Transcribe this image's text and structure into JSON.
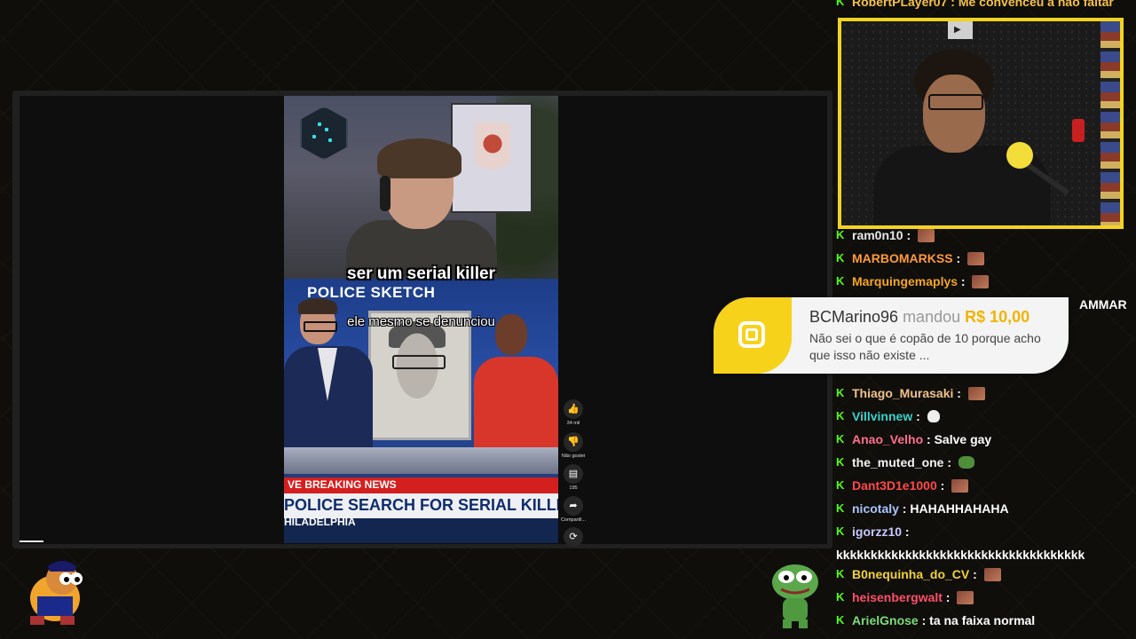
{
  "short": {
    "caption_top": "ser um serial killer",
    "sketch_title": "POLICE SKETCH",
    "caption_bottom": "ele mesmo se denunciou",
    "breaking": "VE  BREAKING NEWS",
    "ticker": "POLICE SEARCH FOR SERIAL KILLER",
    "city": "HILADELPHIA",
    "actions": {
      "like_count": "34 mil",
      "dislike_label": "Não gostei",
      "comments_count": "195",
      "share_label": "Compartil..."
    }
  },
  "donation": {
    "name": "BCMarino96",
    "verb": "mandou",
    "amount": "R$ 10,00",
    "message": "Não sei o que é copão de 10 porque acho que isso não existe ..."
  },
  "chat": {
    "partial_top": "RobertPLayer07 : Me convenceu a não faltar",
    "overflow_text": "AMMAR",
    "messages": [
      {
        "user": "ram0n10",
        "color": "#e8e8e8",
        "text": "",
        "emote": "face"
      },
      {
        "user": "MARBOMARKSS",
        "color": "#ff9a3c",
        "text": "",
        "emote": "face"
      },
      {
        "user": "Marquingemaplys",
        "color": "#f5a623",
        "text": "",
        "emote": "face"
      },
      {
        "user": "Thiago_Murasaki",
        "color": "#f0c28a",
        "text": "",
        "emote": "face"
      },
      {
        "user": "Villvinnew",
        "color": "#3ad1c9",
        "text": "",
        "emote": "skull"
      },
      {
        "user": "Anao_Velho",
        "color": "#ff6f8c",
        "text": "Salve gay",
        "emote": ""
      },
      {
        "user": "the_muted_one",
        "color": "#f2f2f2",
        "text": "",
        "emote": "frog"
      },
      {
        "user": "Dant3D1e1000",
        "color": "#ff4a4a",
        "text": "",
        "emote": "face"
      },
      {
        "user": "nicotaly",
        "color": "#a9c6ff",
        "text": "HAHAHHAHAHA",
        "emote": ""
      },
      {
        "user": "igorzz10",
        "color": "#c8c8ff",
        "text": "",
        "emote": ""
      },
      {
        "user": "B0nequinha_do_CV",
        "color": "#f2d13a",
        "text": "",
        "emote": "face"
      },
      {
        "user": "heisenbergwalt",
        "color": "#ff4f6a",
        "text": "",
        "emote": "face"
      },
      {
        "user": "ArielGnose",
        "color": "#7ddc7a",
        "text": "ta na faixa normal",
        "emote": ""
      }
    ],
    "igorzz10_text": "kkkkkkkkkkkkkkkkkkkkkkkkkkkkkkkkkkkk"
  }
}
